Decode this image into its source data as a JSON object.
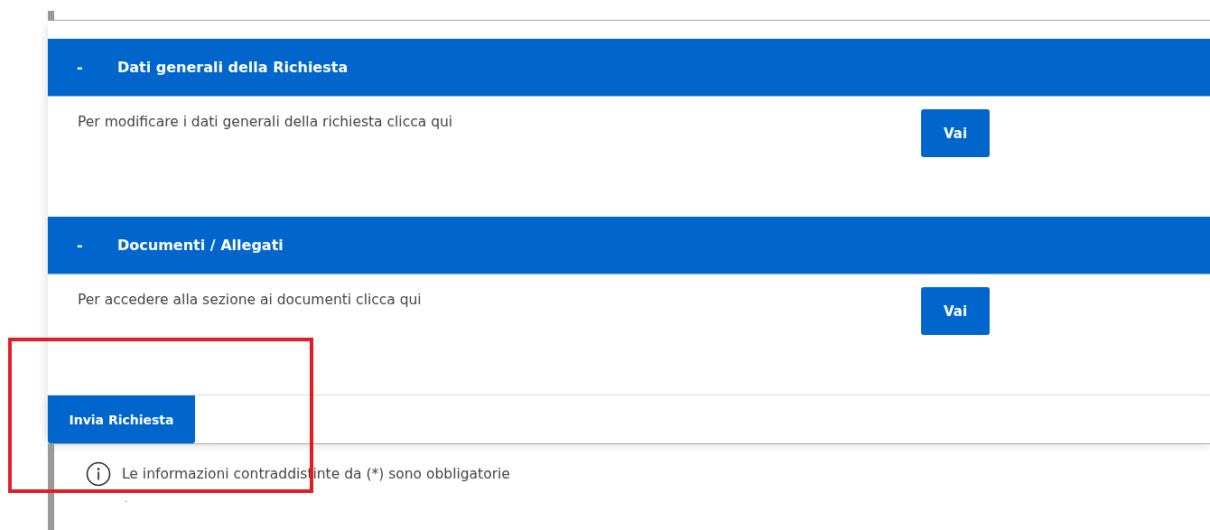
{
  "sections": [
    {
      "toggle": "-",
      "title": "Dati generali della Richiesta",
      "expanded": true,
      "text": "Per modificare i dati generali della richiesta clicca qui",
      "button": "Vai"
    },
    {
      "toggle": "-",
      "title": "Documenti / Allegati",
      "expanded": true,
      "text": "Per accedere alla sezione ai documenti clicca qui",
      "button": "Vai"
    }
  ],
  "submit_button": "Invia Richiesta",
  "info": {
    "text": "Le informazioni contraddistinte da (*) sono obbligatorie",
    "note": "."
  },
  "annotation": {
    "kind": "highlight"
  }
}
